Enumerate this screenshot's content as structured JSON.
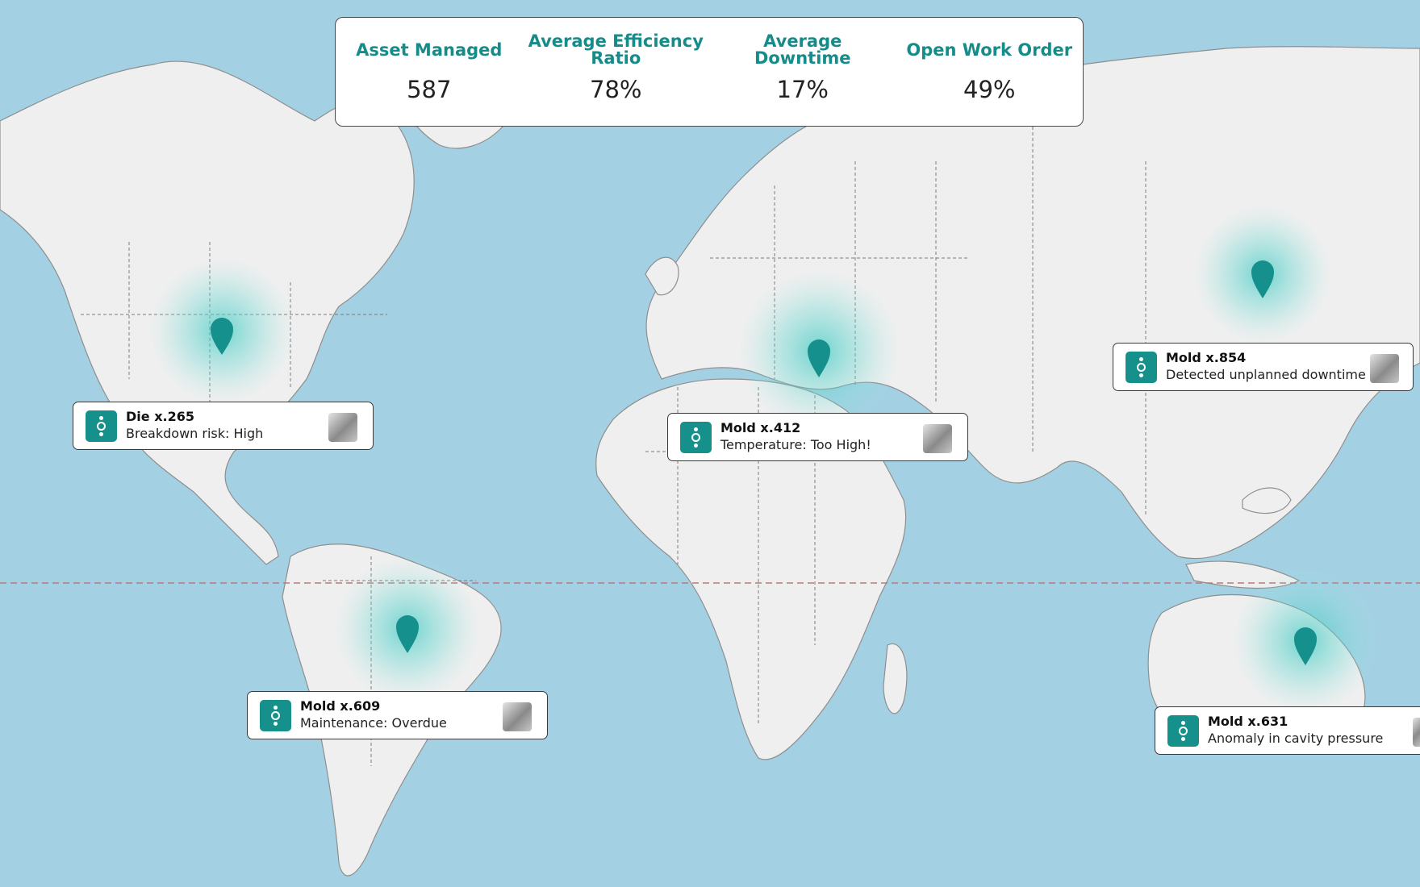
{
  "kpis": [
    {
      "label": "Asset Managed",
      "value": "587"
    },
    {
      "label": "Average Efficiency Ratio",
      "value": "78%"
    },
    {
      "label": "Average Downtime",
      "value": "17%"
    },
    {
      "label": "Open Work Order",
      "value": "49%"
    }
  ],
  "assets": [
    {
      "title": "Die x.265",
      "status": "Breakdown risk: High"
    },
    {
      "title": "Mold x.412",
      "status": "Temperature: Too High!"
    },
    {
      "title": "Mold x.854",
      "status": "Detected unplanned downtime"
    },
    {
      "title": "Mold x.609",
      "status": "Maintenance: Overdue"
    },
    {
      "title": "Mold x.631",
      "status": "Anomaly in cavity pressure"
    }
  ],
  "colors": {
    "ocean": "#a3d1e3",
    "land": "#efefef",
    "accent": "#168c8a",
    "equator": "#b77a7a"
  },
  "icons": {
    "marker": "map-pin-icon",
    "asset": "asset-icon",
    "photo": "machine-thumbnail"
  }
}
